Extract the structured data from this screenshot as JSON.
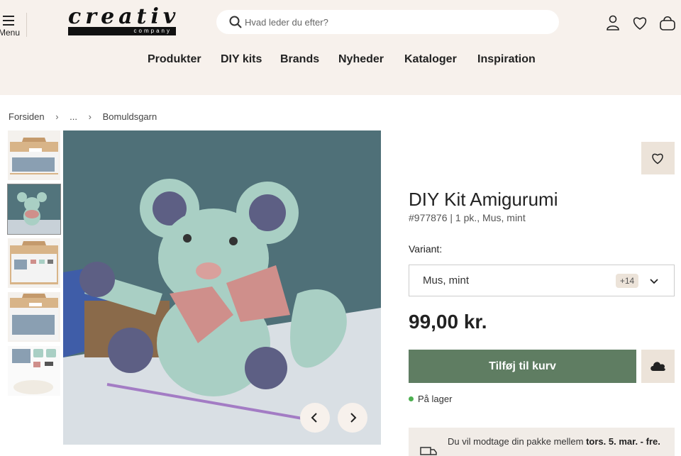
{
  "header": {
    "menu_label": "Menu",
    "logo_text": "creativ",
    "logo_sub": "company",
    "search_placeholder": "Hvad leder du efter?"
  },
  "nav": [
    "Produkter",
    "DIY kits",
    "Brands",
    "Nyheder",
    "Kataloger",
    "Inspiration"
  ],
  "breadcrumb": [
    "Forsiden",
    "...",
    "Bomuldsgarn"
  ],
  "product": {
    "title": "DIY Kit Amigurumi",
    "subtitle": "#977876 | 1 pk., Mus, mint",
    "variant_label": "Variant:",
    "variant_value": "Mus, mint",
    "variant_more": "+14",
    "price": "99,00 kr.",
    "add_to_cart": "Tilføj til kurv",
    "stock": "På lager",
    "delivery_text": "Du vil modtage din pakke mellem ",
    "delivery_dates": "tors. 5. mar. - fre."
  },
  "colors": {
    "header_bg": "#f7f1ec",
    "accent_green": "#5f7d62",
    "beige": "#ece3d9"
  },
  "icons": [
    "menu-icon",
    "search-icon",
    "user-icon",
    "heart-icon",
    "basket-icon",
    "chevron-left-icon",
    "chevron-right-icon",
    "chevron-down-icon",
    "cloud-icon",
    "truck-icon"
  ]
}
